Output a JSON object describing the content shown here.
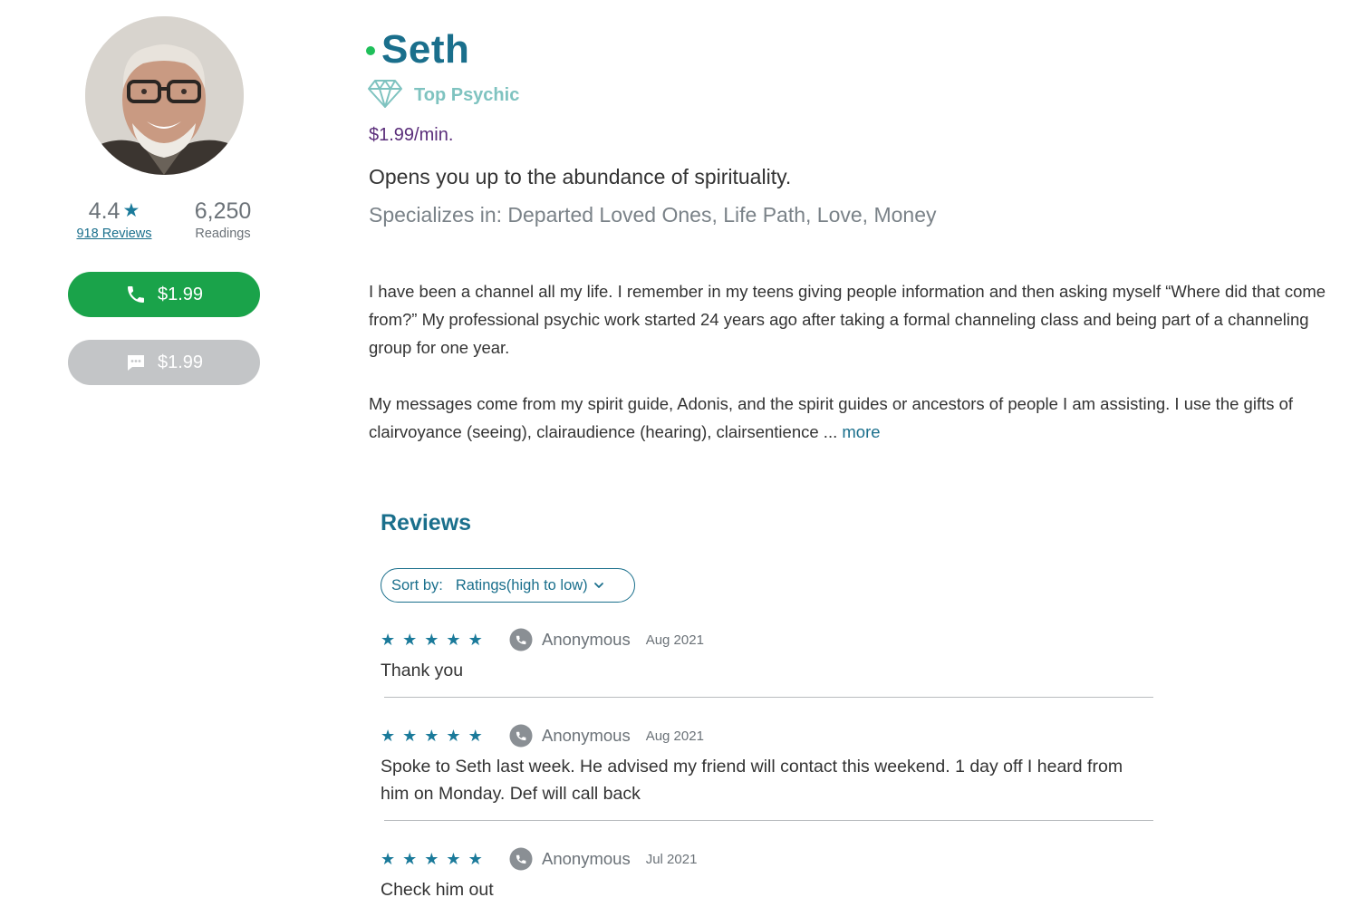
{
  "profile": {
    "name": "Seth",
    "status_color": "#1fbf5a",
    "badge_label": "Top Psychic",
    "badge_icon": "diamond-icon",
    "price": "$1.99/min.",
    "tagline": "Opens you up to the abundance of spirituality.",
    "specializes": "Specializes in: Departed Loved Ones, Life Path, Love, Money"
  },
  "stats": {
    "rating": "4.4",
    "reviews_link": "918 Reviews",
    "readings": "6,250",
    "readings_label": "Readings"
  },
  "actions": {
    "call_label": "$1.99",
    "call_icon": "phone-icon",
    "call_color": "#1aa34a",
    "chat_label": "$1.99",
    "chat_icon": "chat-bubble-icon",
    "chat_color": "#c3c5c7"
  },
  "bio": {
    "p1": "I have been a channel all my life. I remember in my teens giving people information and then asking myself   “Where did that come from?”    My professional psychic work started 24 years ago after taking a formal channeling class and being part of a channeling group for one year.",
    "p2": "My messages come from my spirit guide, Adonis, and the spirit guides or ancestors of people I am assisting. I use the gifts of clairvoyance (seeing), clairaudience (hearing), clairsentience ... ",
    "more": "more"
  },
  "reviews": {
    "title": "Reviews",
    "sort_label": "Sort by:",
    "sort_value": "Ratings(high to low)",
    "items": [
      {
        "stars": 5,
        "author": "Anonymous",
        "date": "Aug 2021",
        "text": "Thank you"
      },
      {
        "stars": 5,
        "author": "Anonymous",
        "date": "Aug 2021",
        "text": "Spoke to Seth last week. He advised my friend will contact this weekend. 1 day off I heard from him on Monday. Def will call back"
      },
      {
        "stars": 5,
        "author": "Anonymous",
        "date": "Jul 2021",
        "text": "Check him out"
      }
    ]
  },
  "colors": {
    "accent": "#1a6f8c",
    "price": "#5a2d7a",
    "star": "#1a7a9a"
  }
}
